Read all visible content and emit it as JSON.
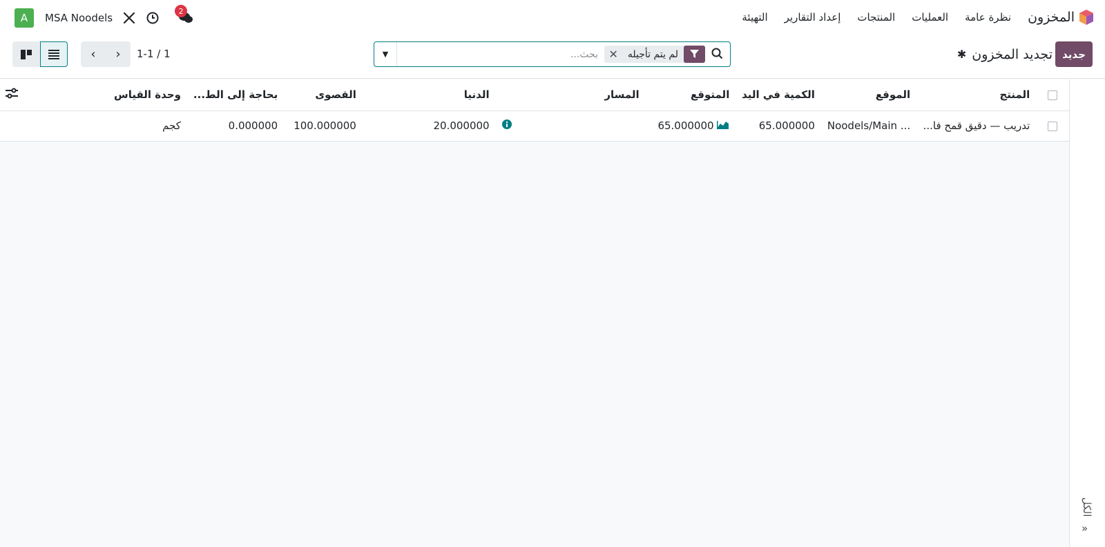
{
  "navbar": {
    "app_name": "المخزون",
    "menu": [
      "نظرة عامة",
      "العمليات",
      "المنتجات",
      "إعداد التقارير",
      "التهيئة"
    ],
    "company": "MSA Noodels",
    "avatar_letter": "A",
    "messages_badge": "2"
  },
  "control": {
    "new_label": "جديد",
    "title": "تجديد المخزون",
    "facet_label": "لم يتم تأجيله",
    "search_placeholder": "بحث...",
    "pager": "1-1 / 1"
  },
  "table": {
    "headers": {
      "product": "المنتج",
      "location": "الموقع",
      "on_hand": "الكمية في اليد",
      "forecast": "المتوقع",
      "route": "المسار",
      "min": "الدنيا",
      "max": "القصوى",
      "to_order": "بحاجة إلى الط...",
      "uom": "وحدة القياس"
    },
    "rows": [
      {
        "product": "تدريب — دقيق قمح فا...",
        "location": "Noodels/Main ...",
        "on_hand": "65.000000",
        "forecast": "65.000000",
        "min": "20.000000",
        "max": "100.000000",
        "to_order": "0.000000",
        "uom": "كجم"
      }
    ]
  },
  "side_panel": {
    "label": "الكل"
  },
  "colors": {
    "brand": "#714b67",
    "accent": "#017e84",
    "avatar": "#4caf50",
    "badge": "#dc3545"
  }
}
